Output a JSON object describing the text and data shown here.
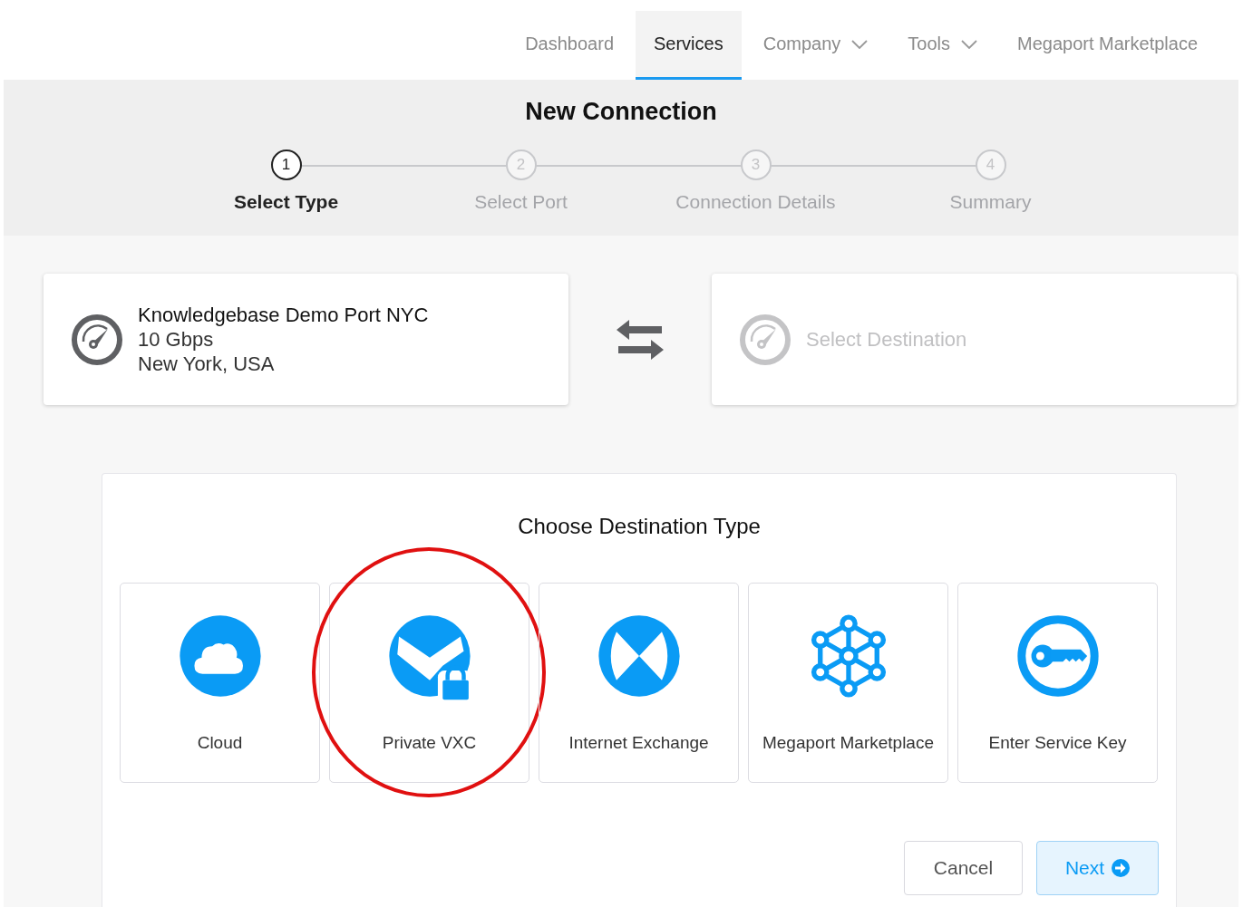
{
  "nav": [
    {
      "label": "Dashboard",
      "selected": false,
      "dropdown": false
    },
    {
      "label": "Services",
      "selected": true,
      "dropdown": false
    },
    {
      "label": "Company",
      "selected": false,
      "dropdown": true
    },
    {
      "label": "Tools",
      "selected": false,
      "dropdown": true
    },
    {
      "label": "Megaport Marketplace",
      "selected": false,
      "dropdown": false
    }
  ],
  "title": "New Connection",
  "steps": [
    {
      "number": "1",
      "label": "Select Type",
      "selected": true
    },
    {
      "number": "2",
      "label": "Select Port",
      "selected": false
    },
    {
      "number": "3",
      "label": "Connection Details",
      "selected": false
    },
    {
      "number": "4",
      "label": "Summary",
      "selected": false
    }
  ],
  "source": {
    "name": "Knowledgebase Demo Port NYC",
    "speed": "10 Gbps",
    "location": "New York, USA"
  },
  "destination": {
    "placeholder": "Select Destination"
  },
  "chooser": {
    "title": "Choose Destination Type",
    "types": [
      {
        "kind": "cloud",
        "label": "Cloud",
        "circled": false
      },
      {
        "kind": "vxc",
        "label": "Private VXC",
        "circled": true
      },
      {
        "kind": "ix",
        "label": "Internet Exchange",
        "circled": false
      },
      {
        "kind": "marketplace",
        "label": "Megaport Marketplace",
        "circled": false
      },
      {
        "kind": "key",
        "label": "Enter Service Key",
        "circled": false
      }
    ]
  },
  "buttons": [
    {
      "kind": "cancel",
      "label": "Cancel"
    },
    {
      "kind": "next",
      "label": "Next"
    }
  ]
}
